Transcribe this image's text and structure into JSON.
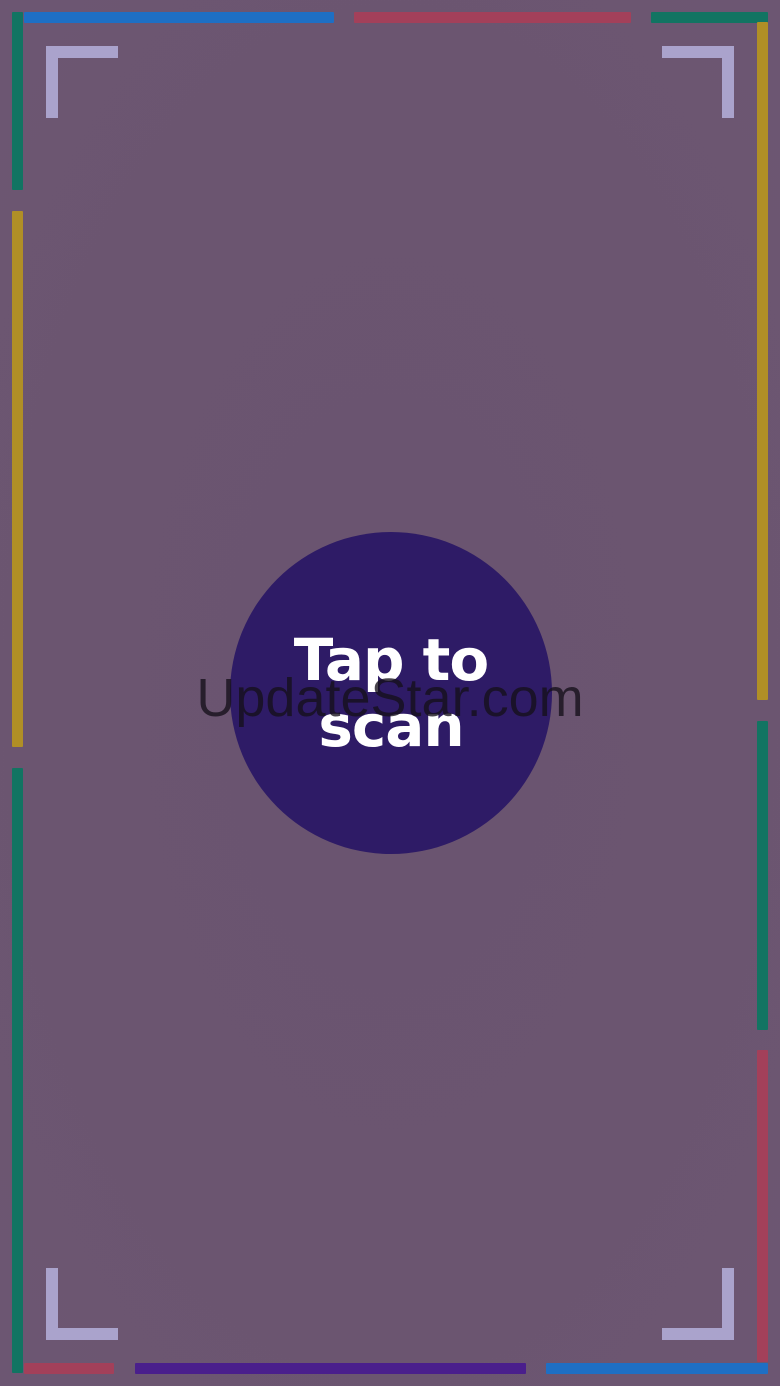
{
  "scan_button": {
    "label": "Tap to scan"
  },
  "watermark": {
    "text": "UpdateStar.com"
  },
  "colors": {
    "background": "#6a5470",
    "button_fill": "#2e1b66",
    "corner_brackets": "#aaa3cc",
    "frame_blue": "#1e6fc4",
    "frame_red": "#a3405a",
    "frame_green": "#127462",
    "frame_yellow": "#b08f26",
    "frame_purple": "#4a1f8c"
  },
  "icons": {
    "corners": [
      "corner-bracket-top-left-icon",
      "corner-bracket-top-right-icon",
      "corner-bracket-bottom-left-icon",
      "corner-bracket-bottom-right-icon"
    ]
  }
}
